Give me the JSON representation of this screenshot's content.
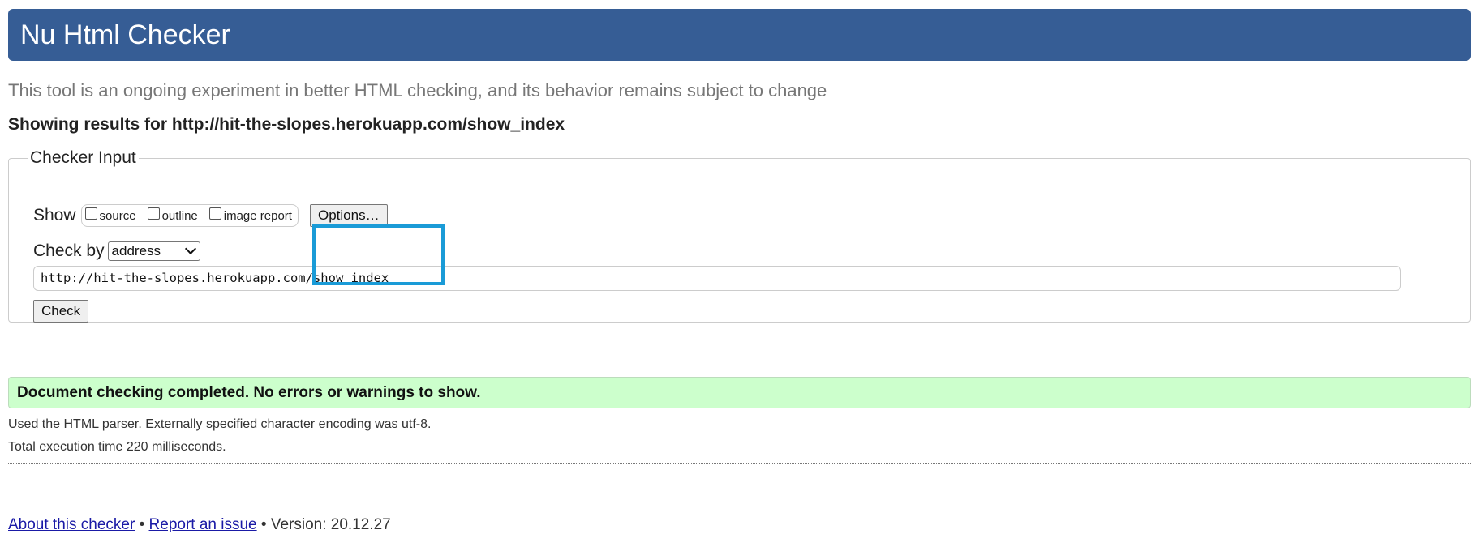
{
  "header": {
    "title": "Nu Html Checker"
  },
  "tagline": "This tool is an ongoing experiment in better HTML checking, and its behavior remains subject to change",
  "results_for": "Showing results for http://hit-the-slopes.herokuapp.com/show_index",
  "checker_input": {
    "legend": "Checker Input",
    "show_label": "Show",
    "show_options": [
      {
        "label": "source",
        "checked": false
      },
      {
        "label": "outline",
        "checked": false
      },
      {
        "label": "image report",
        "checked": false
      }
    ],
    "options_button": "Options…",
    "check_by_label": "Check by",
    "check_by_selected": "address",
    "url_value": "http://hit-the-slopes.herokuapp.com/show_index",
    "check_button": "Check"
  },
  "result": {
    "success_message": "Document checking completed. No errors or warnings to show.",
    "parser_info": "Used the HTML parser. Externally specified character encoding was utf-8.",
    "execution_time": "Total execution time 220 milliseconds."
  },
  "footer": {
    "about_link": "About this checker",
    "separator": "•",
    "report_link": "Report an issue",
    "version": "Version: 20.12.27"
  },
  "colors": {
    "header_bg": "#365d95",
    "success_bg": "#ccffcc",
    "highlight": "#1a9bd7",
    "link": "#1a1aa6"
  },
  "icons": {
    "select_arrow": "chevron-down-icon"
  }
}
